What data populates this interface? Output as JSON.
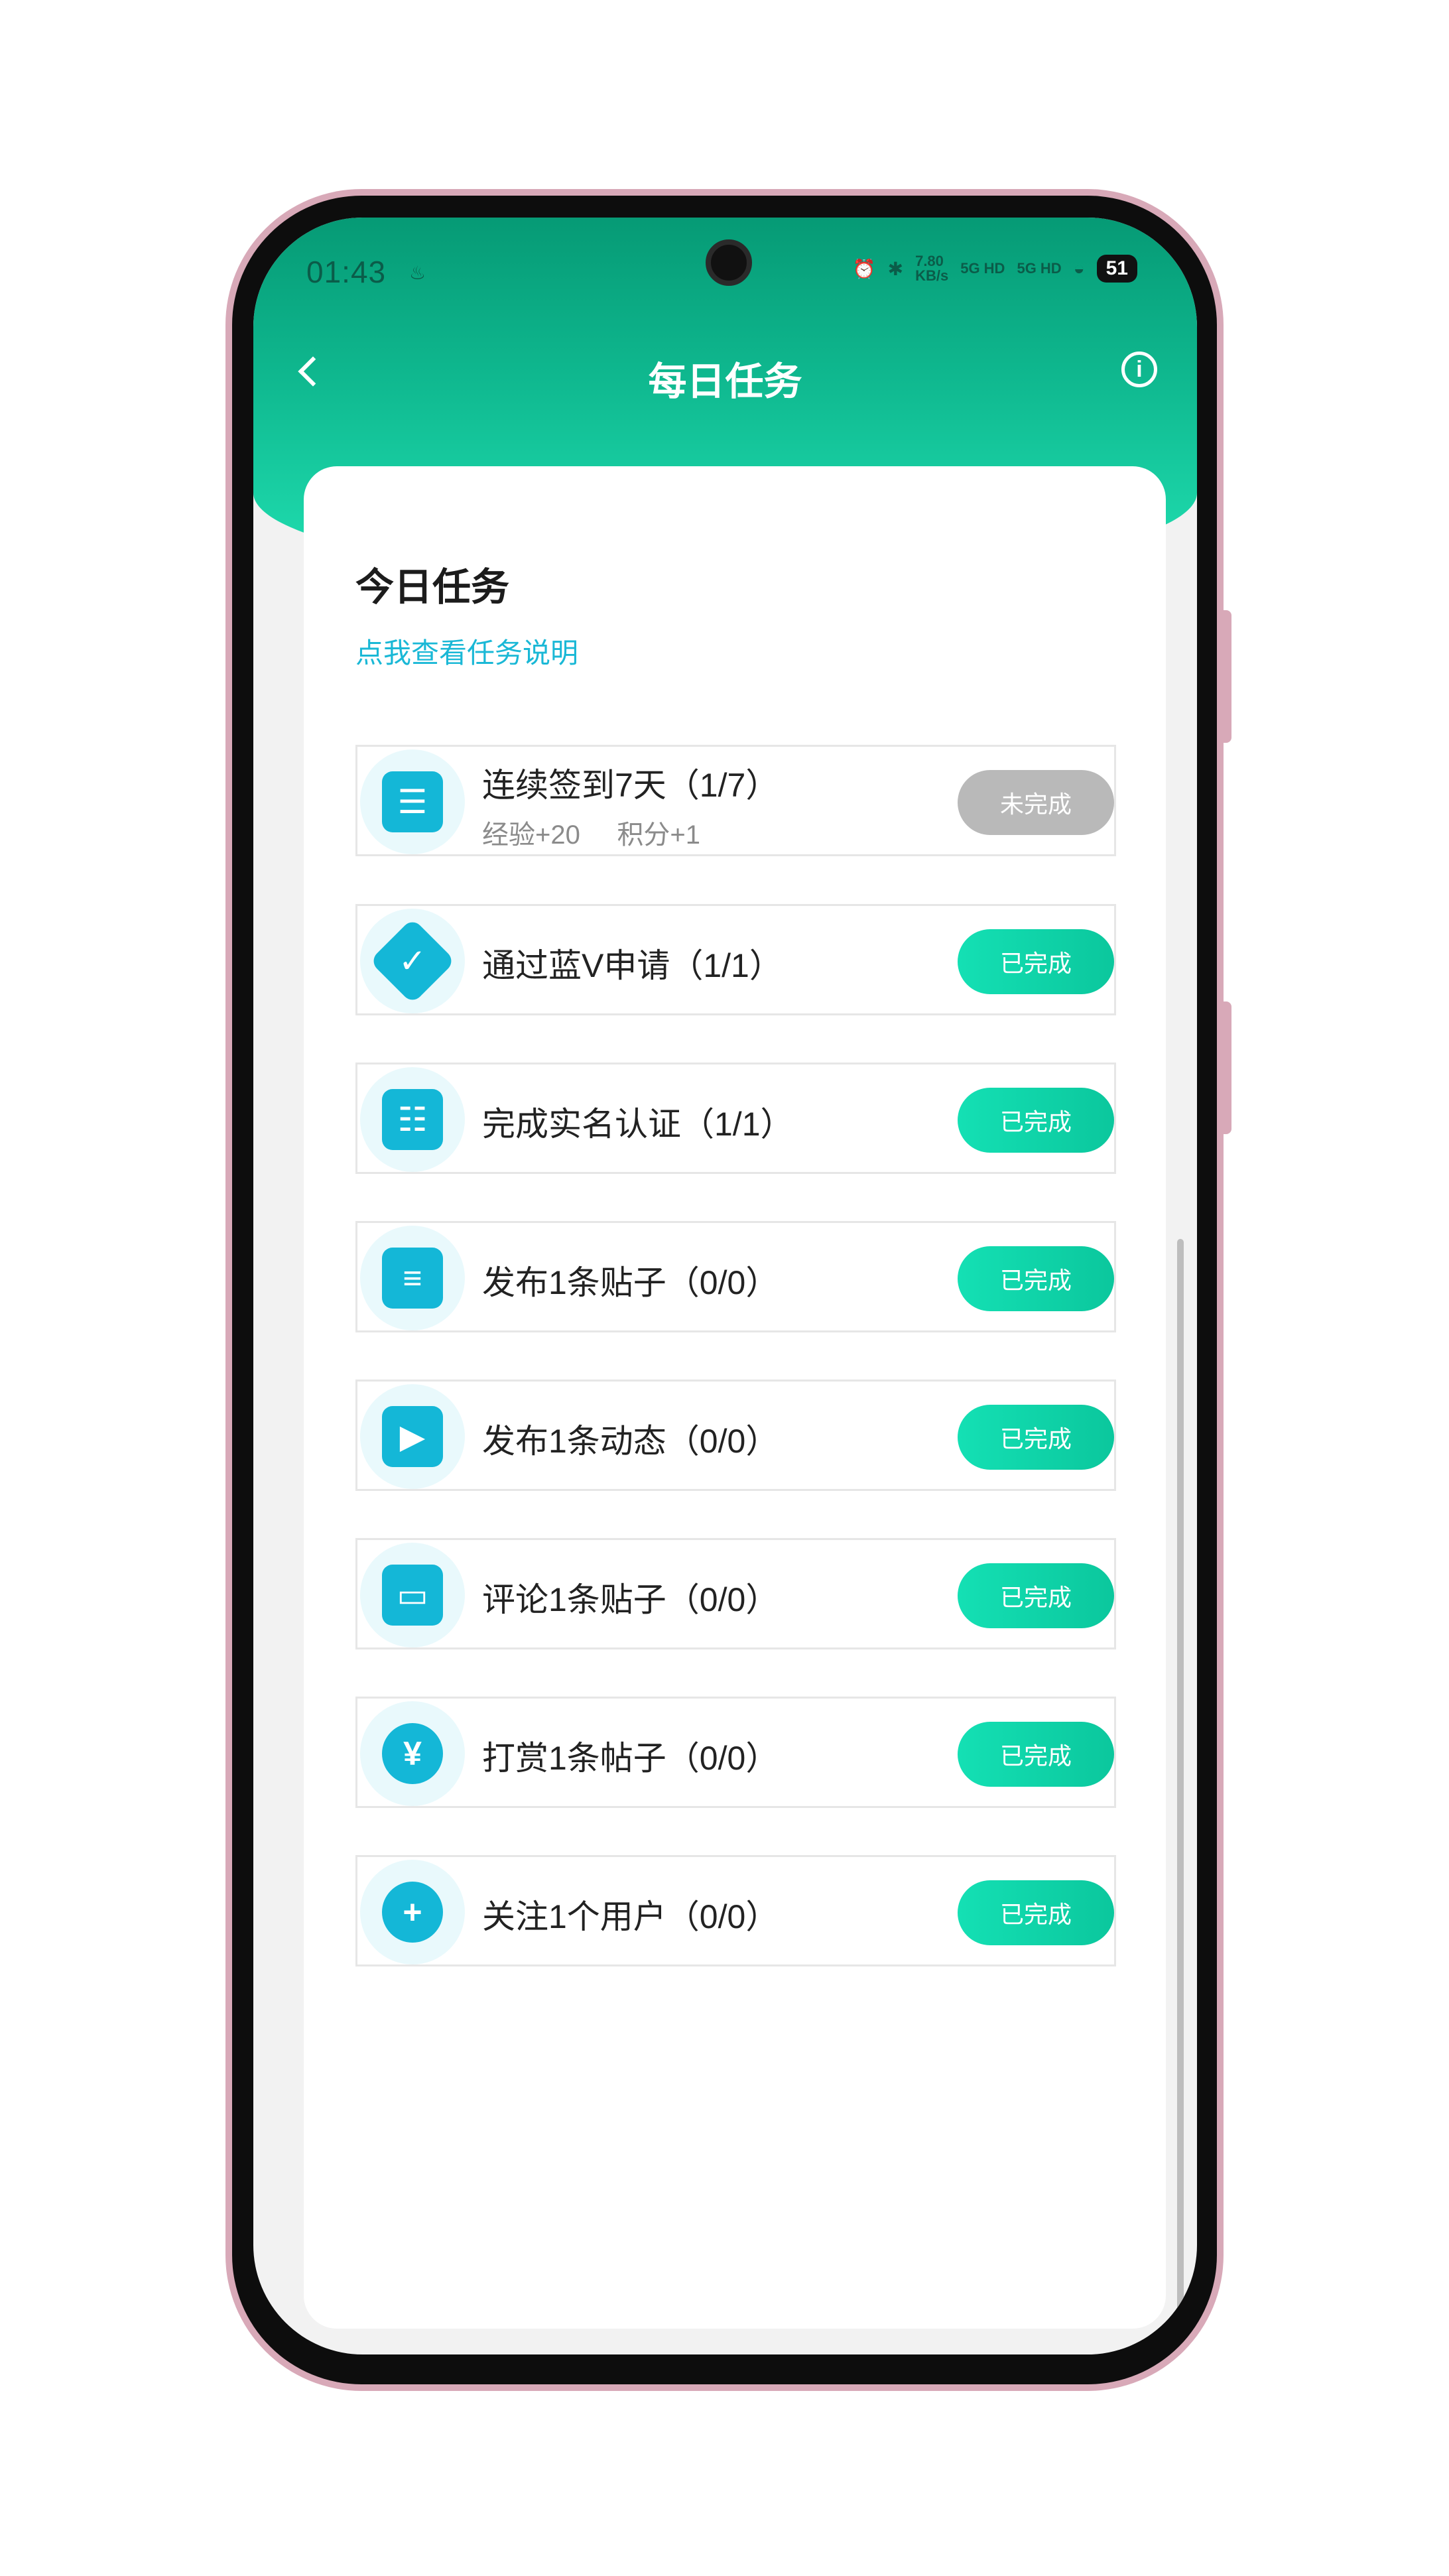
{
  "status_bar": {
    "time": "01:43",
    "time_suffix": "♨",
    "alarm": "⏰",
    "bluetooth": "✱",
    "net_speed": "7.80",
    "net_unit": "KB/s",
    "signal1": "5G HD",
    "signal2": "5G HD",
    "wifi": "◒",
    "battery": "51"
  },
  "header": {
    "title": "每日任务",
    "back_icon": "chevron-left-icon",
    "info_icon": "info-icon",
    "info_glyph": "i"
  },
  "section": {
    "title": "今日任务",
    "link": "点我查看任务说明"
  },
  "tasks": [
    {
      "name": "连续签到7天（1/7）",
      "reward_exp": "经验+20",
      "reward_points": "积分+1",
      "status": "未完成",
      "icon": "calendar-icon",
      "glyph": "☰"
    },
    {
      "name": "通过蓝V申请（1/1）",
      "status": "已完成",
      "icon": "verified-badge-icon",
      "glyph": "✓"
    },
    {
      "name": "完成实名认证（1/1）",
      "status": "已完成",
      "icon": "id-card-icon",
      "glyph": "☷"
    },
    {
      "name": "发布1条贴子（0/0）",
      "status": "已完成",
      "icon": "post-icon",
      "glyph": "≡"
    },
    {
      "name": "发布1条动态（0/0）",
      "status": "已完成",
      "icon": "video-camera-icon",
      "glyph": "▶"
    },
    {
      "name": "评论1条贴子（0/0）",
      "status": "已完成",
      "icon": "comment-icon",
      "glyph": "▭"
    },
    {
      "name": "打赏1条帖子（0/0）",
      "status": "已完成",
      "icon": "yen-coin-icon",
      "glyph": "¥"
    },
    {
      "name": "关注1个用户（0/0）",
      "status": "已完成",
      "icon": "plus-circle-icon",
      "glyph": "+"
    }
  ],
  "colors": {
    "header_top": "#069a75",
    "header_bottom": "#20dfb1",
    "accent_link": "#1ab8d6",
    "icon_bg": "#14b7d7",
    "done_button": "#0fd0a6",
    "pending_button": "#b9b9b9"
  }
}
